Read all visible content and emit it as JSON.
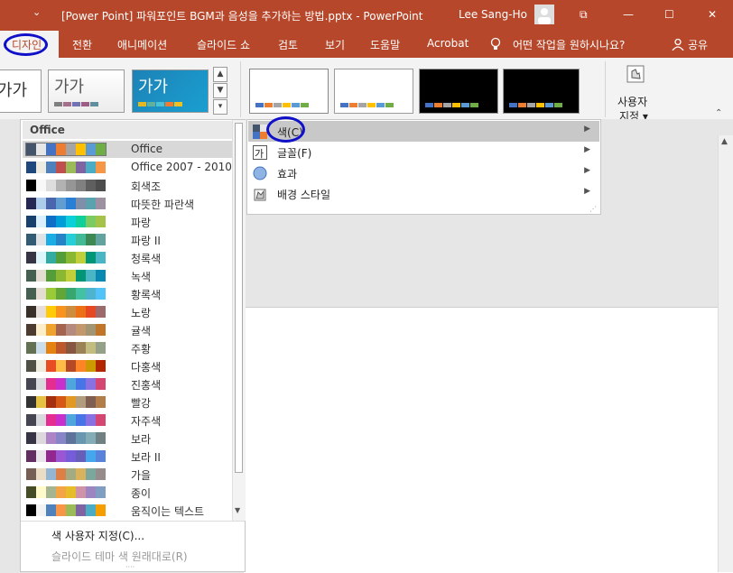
{
  "window": {
    "title": "[Power Point] 파워포인트 BGM과 음성을 추가하는 방법.pptx  -  PowerPoint",
    "user": "Lee Sang-Ho",
    "quick_access_glyph": "⌄",
    "controls": {
      "ribbon_display": "⧉",
      "minimize": "—",
      "maximize": "☐",
      "close": "✕"
    }
  },
  "tabs": [
    {
      "label": "디자인"
    },
    {
      "label": "전환"
    },
    {
      "label": "애니메이션"
    },
    {
      "label": "슬라이드 쇼"
    },
    {
      "label": "검토"
    },
    {
      "label": "보기"
    },
    {
      "label": "도움말"
    },
    {
      "label": "Acrobat"
    }
  ],
  "tell_me": "어떤 작업을 원하시나요?",
  "share": "공유",
  "ribbon": {
    "theme_sample_text": "가가",
    "customize_label_line1": "사용자",
    "customize_label_line2": "지정 ▾",
    "variant_colors": [
      [
        "#4472c4",
        "#ed7d31",
        "#a5a5a5",
        "#ffc000",
        "#5b9bd5",
        "#70ad47"
      ],
      [
        "#4472c4",
        "#ed7d31",
        "#a5a5a5",
        "#ffc000",
        "#5b9bd5",
        "#70ad47"
      ],
      [
        "#4472c4",
        "#ed7d31",
        "#a5a5a5",
        "#ffc000",
        "#5b9bd5",
        "#70ad47"
      ],
      [
        "#4472c4",
        "#ed7d31",
        "#a5a5a5",
        "#ffc000",
        "#5b9bd5",
        "#70ad47"
      ]
    ]
  },
  "color_menu": {
    "header": "Office",
    "schemes": [
      {
        "name": "Office",
        "colors": [
          "#44546a",
          "#e7e6e6",
          "#4472c4",
          "#ed7d31",
          "#a5a5a5",
          "#ffc000",
          "#5b9bd5",
          "#70ad47"
        ]
      },
      {
        "name": "Office 2007 - 2010",
        "colors": [
          "#1f497d",
          "#eeece1",
          "#4f81bd",
          "#c0504d",
          "#9bbb59",
          "#8064a2",
          "#4bacc6",
          "#f79646"
        ]
      },
      {
        "name": "회색조",
        "colors": [
          "#000000",
          "#f8f8f8",
          "#dddddd",
          "#b2b2b2",
          "#969696",
          "#808080",
          "#5f5f5f",
          "#4d4d4d"
        ]
      },
      {
        "name": "따뜻한 파란색",
        "colors": [
          "#242852",
          "#acccea",
          "#4a66ac",
          "#629dd1",
          "#297fd5",
          "#7f8fa9",
          "#5aa2ae",
          "#9d90a0"
        ]
      },
      {
        "name": "파랑",
        "colors": [
          "#17406d",
          "#dbefff",
          "#0f6fc6",
          "#009dd9",
          "#0bd0d9",
          "#10cf9b",
          "#7cca62",
          "#a5c249"
        ]
      },
      {
        "name": "파랑 II",
        "colors": [
          "#335b74",
          "#dfe3e5",
          "#1cade4",
          "#2683c6",
          "#27ced7",
          "#42ba97",
          "#3e8853",
          "#62a39f"
        ]
      },
      {
        "name": "청록색",
        "colors": [
          "#373545",
          "#def5fa",
          "#34aba2",
          "#549e39",
          "#8ab833",
          "#c0cf3a",
          "#029676",
          "#4ab5c4"
        ]
      },
      {
        "name": "녹색",
        "colors": [
          "#455f51",
          "#e3ded1",
          "#549e39",
          "#8ab833",
          "#c0cf3a",
          "#029676",
          "#4ab5c4",
          "#0989b1"
        ]
      },
      {
        "name": "황록색",
        "colors": [
          "#455f51",
          "#e3ded1",
          "#99cb38",
          "#63a537",
          "#37a76f",
          "#44c1a3",
          "#4eb3cf",
          "#51c3f9"
        ]
      },
      {
        "name": "노랑",
        "colors": [
          "#39302a",
          "#e5dedb",
          "#ffca08",
          "#f8931d",
          "#ce8d3e",
          "#ec7016",
          "#e64823",
          "#9c6a6a"
        ]
      },
      {
        "name": "귤색",
        "colors": [
          "#4e3b30",
          "#fbeec9",
          "#f0a22e",
          "#a5644e",
          "#b58b80",
          "#c3986d",
          "#a19574",
          "#c17529"
        ]
      },
      {
        "name": "주황",
        "colors": [
          "#637052",
          "#ccddea",
          "#e48312",
          "#bd582c",
          "#865640",
          "#9b8357",
          "#c2bc80",
          "#94a088"
        ]
      },
      {
        "name": "다홍색",
        "colors": [
          "#505046",
          "#eeece1",
          "#e84c22",
          "#ffbd47",
          "#b64926",
          "#ff8427",
          "#cc9900",
          "#b22600"
        ]
      },
      {
        "name": "진홍색",
        "colors": [
          "#454551",
          "#d8d9dc",
          "#e32d91",
          "#c830cc",
          "#4ea6dc",
          "#4775e7",
          "#8971e1",
          "#d54773"
        ]
      },
      {
        "name": "빨강",
        "colors": [
          "#323232",
          "#e5c243",
          "#a5300f",
          "#d55816",
          "#e19825",
          "#b19c7d",
          "#7f5f52",
          "#b27d49"
        ]
      },
      {
        "name": "자주색",
        "colors": [
          "#454551",
          "#d8d9dc",
          "#e32d91",
          "#c830cc",
          "#4ea6dc",
          "#4775e7",
          "#8971e1",
          "#d54773"
        ]
      },
      {
        "name": "보라",
        "colors": [
          "#373545",
          "#dcd8dc",
          "#ad84c6",
          "#8784c7",
          "#5d739a",
          "#6997af",
          "#84acb6",
          "#6f8183"
        ]
      },
      {
        "name": "보라 II",
        "colors": [
          "#632e62",
          "#eae5eb",
          "#92278f",
          "#9b57d3",
          "#755dd9",
          "#665eb8",
          "#45a5ed",
          "#5982db"
        ]
      },
      {
        "name": "가을",
        "colors": [
          "#775f55",
          "#ebddc3",
          "#94b6d2",
          "#dd8047",
          "#a5ab81",
          "#d8b25c",
          "#7ba79d",
          "#968c8c"
        ]
      },
      {
        "name": "종이",
        "colors": [
          "#444d26",
          "#fefac9",
          "#a5b592",
          "#f3a447",
          "#e7bc29",
          "#d092a7",
          "#9c85c0",
          "#809ec2"
        ]
      },
      {
        "name": "움직이는 텍스트",
        "colors": [
          "#000000",
          "#f2f2f2",
          "#4f81bd",
          "#f79646",
          "#9bbb59",
          "#8064a2",
          "#4bacc6",
          "#f59e00"
        ]
      }
    ],
    "customize": "색 사용자 지정(C)...",
    "reset": "슬라이드 테마 색 원래대로(R)"
  },
  "submenu": {
    "items": [
      {
        "label": "색(C)",
        "icon": "color-palette-icon"
      },
      {
        "label": "글꼴(F)",
        "icon": "font-icon"
      },
      {
        "label": "효과",
        "icon": "effects-icon"
      },
      {
        "label": "배경 스타일",
        "icon": "background-style-icon"
      }
    ]
  },
  "colors": {
    "accent": "#b7472a",
    "highlight_circle": "#1010c8"
  }
}
